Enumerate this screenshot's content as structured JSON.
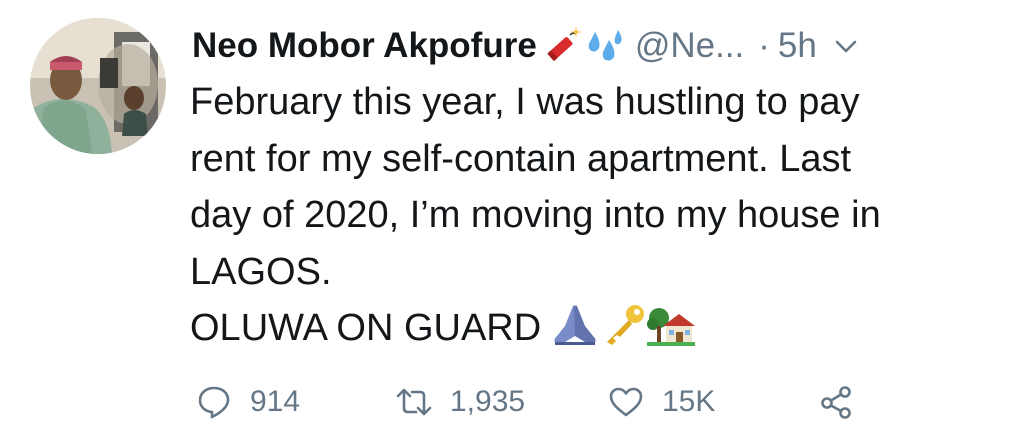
{
  "tweet": {
    "author": {
      "name": "Neo Mobor Akpofure",
      "name_emojis": [
        "firecracker-icon",
        "sweat-droplets-icon"
      ],
      "handle": "@Ne...",
      "avatar": "avatar-photo"
    },
    "separator": "·",
    "time": "5h",
    "menu_icon": "chevron-down-icon",
    "text_lines": [
      "February this year, I was hustling to pay",
      "rent for my self-contain apartment. Last",
      "day of 2020, I’m moving into my house in",
      "LAGOS.",
      "OLUWA ON GUARD"
    ],
    "trailing_emojis": [
      "folded-hands-icon",
      "key-icon",
      "house-with-garden-icon"
    ],
    "actions": {
      "reply": {
        "icon": "reply-icon",
        "count": "914"
      },
      "retweet": {
        "icon": "retweet-icon",
        "count": "1,935"
      },
      "like": {
        "icon": "heart-icon",
        "count": "15K"
      },
      "share": {
        "icon": "share-icon"
      }
    },
    "colors": {
      "text": "#14171a",
      "secondary": "#657786"
    }
  }
}
